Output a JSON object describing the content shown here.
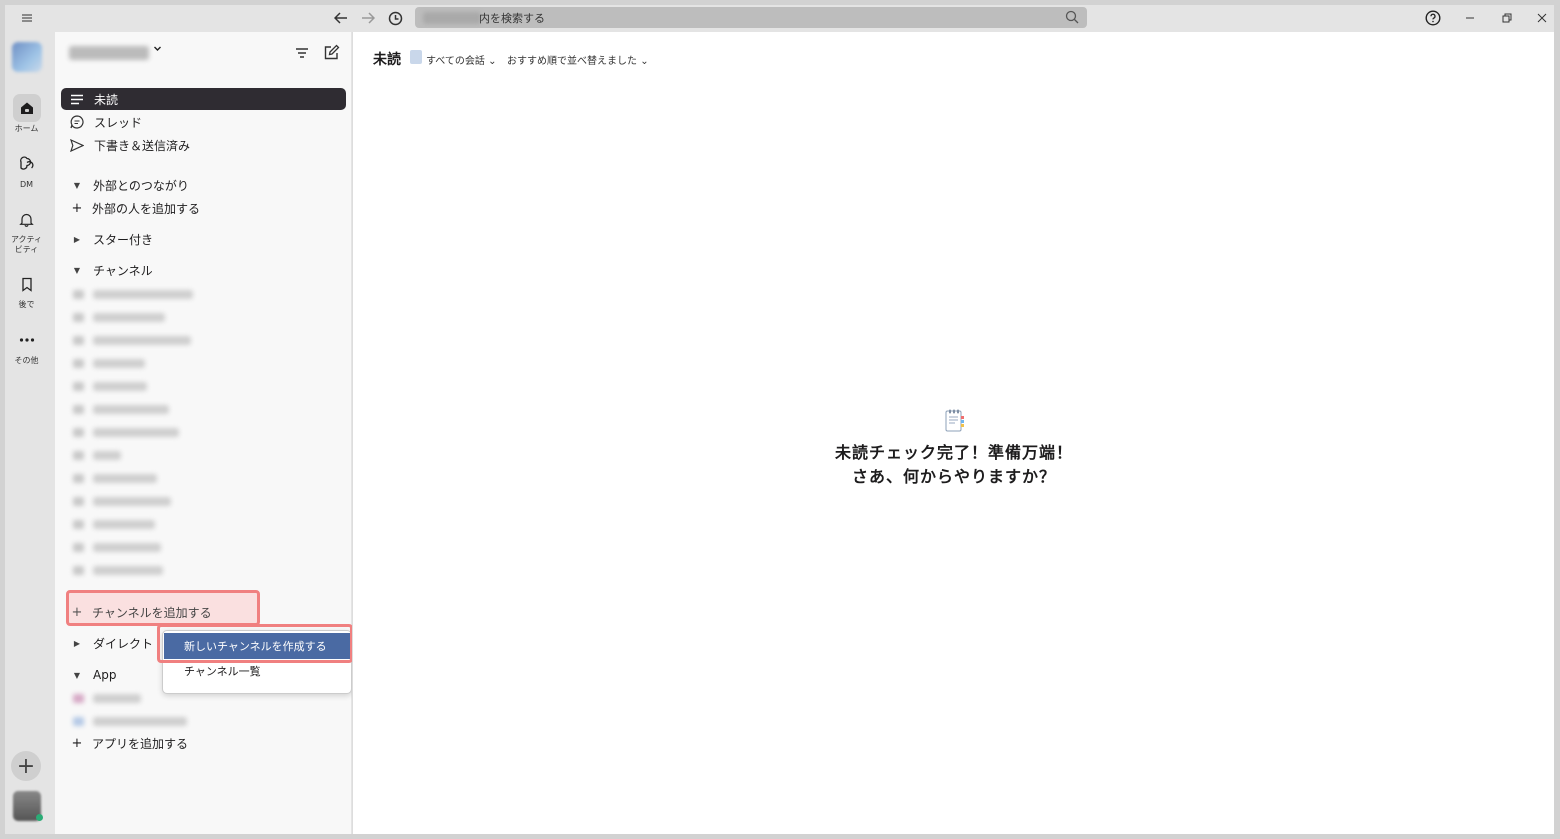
{
  "topbar": {
    "search_placeholder": "内を検索する"
  },
  "rail": {
    "items": [
      {
        "label": "ホーム",
        "icon": "home-icon"
      },
      {
        "label": "DM",
        "icon": "dm-icon"
      },
      {
        "label_line1": "アクティ",
        "label_line2": "ビティ",
        "icon": "bell-icon"
      },
      {
        "label": "後で",
        "icon": "bookmark-icon"
      },
      {
        "label": "その他",
        "icon": "more-icon"
      }
    ]
  },
  "sidebar": {
    "nav": [
      {
        "label": "未読",
        "icon": "unread-icon"
      },
      {
        "label": "スレッド",
        "icon": "threads-icon"
      },
      {
        "label": "下書き＆送信済み",
        "icon": "send-icon"
      }
    ],
    "external_section": "外部とのつながり",
    "add_external": "外部の人を追加する",
    "starred_section": "スター付き",
    "channels_section": "チャンネル",
    "add_channel": "チャンネルを追加する",
    "direct_section": "ダイレクト",
    "app_section": "App",
    "add_app": "アプリを追加する"
  },
  "menu": {
    "create_channel": "新しいチャンネルを作成する",
    "browse_channels": "チャンネル一覧"
  },
  "main": {
    "title": "未読",
    "filter_all": "すべての会話",
    "filter_sort": "おすすめ順で並べ替えました",
    "empty_line1": "未読チェック完了！準備万端！",
    "empty_line2": "さあ、何からやりますか？"
  },
  "colors": {
    "selected_bg": "#2f2c32",
    "menu_highlight": "#4a6aa3",
    "highlight_border": "#f08080"
  }
}
